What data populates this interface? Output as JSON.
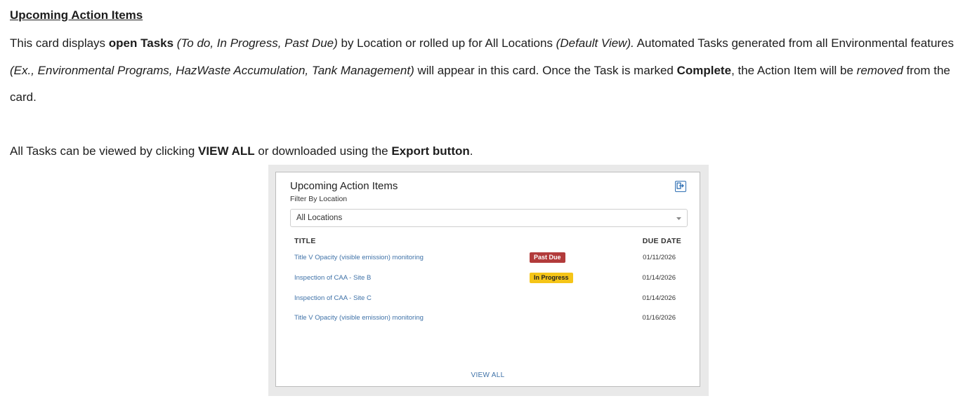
{
  "doc": {
    "heading": "Upcoming Action Items",
    "p1": {
      "t1": "This card displays ",
      "b1": "open Tasks",
      "i1": " (To do, In Progress, Past Due)",
      "t2": " by Location or rolled up for All Locations ",
      "i2": "(Default View).",
      "t3": " Automated Tasks generated from all Environmental features ",
      "i3": "(Ex., Environmental Programs, HazWaste Accumulation, Tank Management)",
      "t4": " will appear in this card. Once the Task is marked ",
      "b2": "Complete",
      "t5": ", the Action Item will be ",
      "i4": "removed",
      "t6": " from the card."
    },
    "p2": {
      "t1": "All Tasks can be viewed by clicking ",
      "b1": "VIEW ALL",
      "t2": " or downloaded using the ",
      "b2": "Export button",
      "t3": "."
    }
  },
  "card": {
    "title": "Upcoming Action Items",
    "filter_label": "Filter By Location",
    "filter_value": "All Locations",
    "export_icon": "export-icon",
    "columns": {
      "title": "TITLE",
      "due": "DUE DATE"
    },
    "rows": [
      {
        "title": "Title V Opacity (visible emission) monitoring",
        "status": "Past Due",
        "due": "01/11/2026"
      },
      {
        "title": "Inspection of CAA - Site B",
        "status": "In Progress",
        "due": "01/14/2026"
      },
      {
        "title": "Inspection of CAA - Site C",
        "status": "",
        "due": "01/14/2026"
      },
      {
        "title": "Title V Opacity (visible emission) monitoring",
        "status": "",
        "due": "01/16/2026"
      }
    ],
    "view_all": "VIEW ALL",
    "colors": {
      "past_due": "#b23b3b",
      "in_progress": "#f5c518",
      "link": "#3f72a8"
    }
  }
}
